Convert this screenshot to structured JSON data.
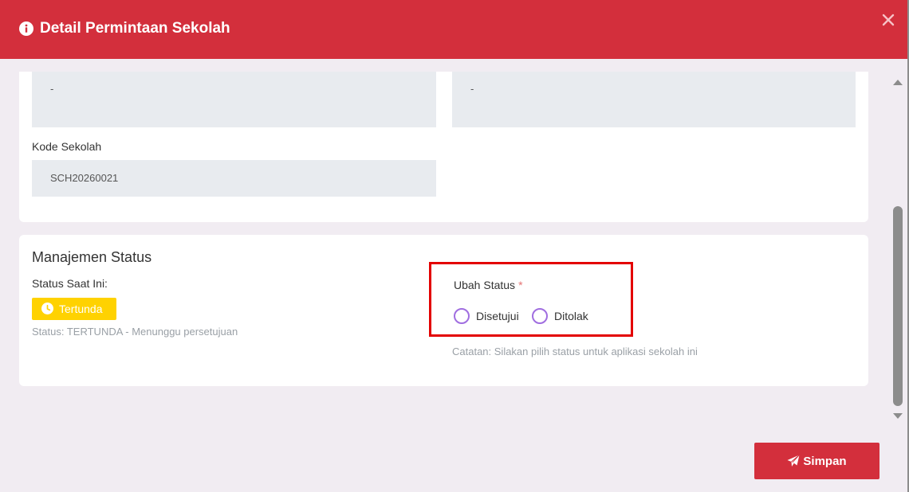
{
  "header": {
    "title": "Detail Permintaan Sekolah",
    "icon": "info-circle-icon",
    "close_icon": "close-icon",
    "bg_color": "#d32f3c"
  },
  "detail_card": {
    "field_left_value": "-",
    "field_right_value": "-",
    "kode_label": "Kode Sekolah",
    "kode_value": "SCH20260021"
  },
  "status_card": {
    "title": "Manajemen Status",
    "current_label": "Status Saat Ini:",
    "badge_text": "Tertunda",
    "badge_color": "#ffd200",
    "status_note": "Status: TERTUNDA - Menunggu persetujuan",
    "change_label": "Ubah Status",
    "required_mark": "*",
    "options": [
      "Disetujui",
      "Ditolak"
    ],
    "catatan": "Catatan: Silakan pilih status untuk aplikasi sekolah ini"
  },
  "footer": {
    "save_label": "Simpan",
    "save_icon": "paper-plane-icon"
  }
}
